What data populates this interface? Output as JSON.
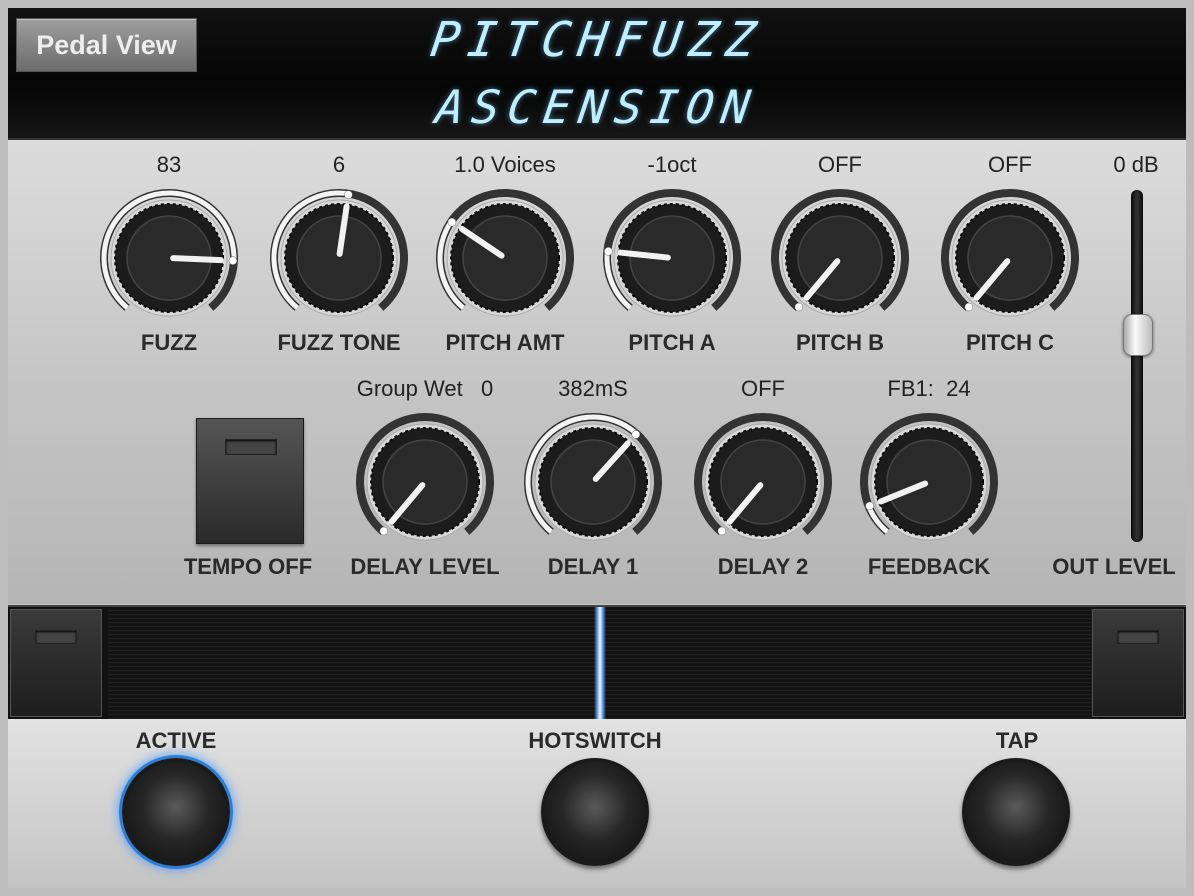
{
  "display": {
    "view_button": "Pedal View",
    "line1": "PITCHFUZZ",
    "line2": "ASCENSION"
  },
  "knobs_row1": [
    {
      "name": "fuzz-knob",
      "label": "FUZZ",
      "value": "83",
      "level": 0.83
    },
    {
      "name": "fuzz-tone-knob",
      "label": "FUZZ TONE",
      "value": "6",
      "level": 0.53
    },
    {
      "name": "pitch-amt-knob",
      "label": "PITCH AMT",
      "value": "1.0 Voices",
      "level": 0.3
    },
    {
      "name": "pitch-a-knob",
      "label": "PITCH A",
      "value": "-1oct",
      "level": 0.2
    },
    {
      "name": "pitch-b-knob",
      "label": "PITCH B",
      "value": "OFF",
      "level": 0.0
    },
    {
      "name": "pitch-c-knob",
      "label": "PITCH C",
      "value": "OFF",
      "level": 0.0
    }
  ],
  "knobs_row2": [
    {
      "name": "delay-level-knob",
      "label": "DELAY LEVEL",
      "value": "Group Wet   0",
      "level": 0.0
    },
    {
      "name": "delay-1-knob",
      "label": "DELAY 1",
      "value": "382mS",
      "level": 0.65
    },
    {
      "name": "delay-2-knob",
      "label": "DELAY 2",
      "value": "OFF",
      "level": 0.0
    },
    {
      "name": "feedback-knob",
      "label": "FEEDBACK",
      "value": "FB1:  24",
      "level": 0.1
    }
  ],
  "tempo": {
    "label": "TEMPO OFF"
  },
  "out_level": {
    "label": "OUT LEVEL",
    "value": "0 dB",
    "level": 0.5
  },
  "expression": {
    "position": 0.5
  },
  "footswitches": [
    {
      "name": "active",
      "label": "ACTIVE",
      "lit": true
    },
    {
      "name": "hotswitch",
      "label": "HOTSWITCH",
      "lit": false
    },
    {
      "name": "tap",
      "label": "TAP",
      "lit": false
    }
  ],
  "colors": {
    "lcd_text": "#bfeeff",
    "active_ring": "#2c7ed6"
  }
}
